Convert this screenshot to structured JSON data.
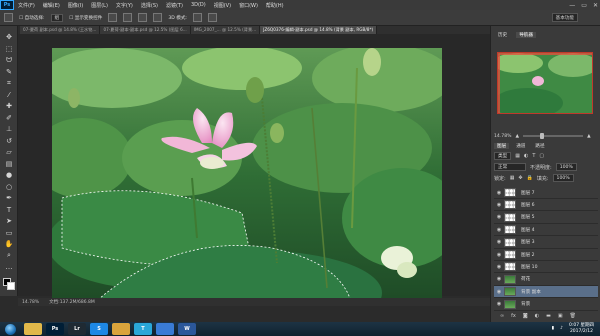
{
  "app": {
    "logo": "Ps"
  },
  "menubar": {
    "items": [
      "文件(F)",
      "编辑(E)",
      "图像(I)",
      "图层(L)",
      "文字(Y)",
      "选择(S)",
      "滤镜(T)",
      "3D(D)",
      "视图(V)",
      "窗口(W)",
      "帮助(H)"
    ],
    "controls": [
      "—",
      "▭",
      "✕"
    ]
  },
  "options": {
    "auto_select_label": "自动选择:",
    "auto_select_value": "组",
    "transform_label": "显示变换控件",
    "mode_label": "3D 模式:",
    "workspace": "基本功能"
  },
  "tabs": [
    {
      "label": "07-夏荷 副本.psd @ 14.8% (王水铭...",
      "active": false
    },
    {
      "label": "07-夏荷-副本-副本.psd @ 12.5% (图层 6...",
      "active": false
    },
    {
      "label": "IMG_2007_... @ 12.5% (背景...",
      "active": false
    },
    {
      "label": "JZ6Q0376-编辑-副本.psd @ 14.8% (背景 副本, RGB/8*)",
      "active": true
    }
  ],
  "tools": [
    "move-icon",
    "marquee-icon",
    "lasso-icon",
    "quick-select-icon",
    "crop-icon",
    "eyedropper-icon",
    "healing-icon",
    "brush-icon",
    "stamp-icon",
    "history-brush-icon",
    "eraser-icon",
    "gradient-icon",
    "blur-icon",
    "dodge-icon",
    "pen-icon",
    "type-icon",
    "path-select-icon",
    "shape-icon",
    "hand-icon",
    "zoom-icon",
    "more-icon"
  ],
  "status": {
    "zoom": "14.78%",
    "doc": "文档:137.2M/686.8M"
  },
  "navigator": {
    "tabs": [
      "历史",
      "导航器"
    ],
    "zoom": "14.78%",
    "zoom_fraction": 0.3
  },
  "layers": {
    "tabs": [
      "图层",
      "通道",
      "路径"
    ],
    "filter_label": "类型",
    "blend_mode": "正常",
    "opacity_label": "不透明度:",
    "opacity": "100%",
    "lock_label": "锁定:",
    "fill_label": "填充:",
    "fill": "100%",
    "rows": [
      {
        "name": "图层 7",
        "thumb": "checker",
        "selected": false
      },
      {
        "name": "图层 6",
        "thumb": "checker",
        "selected": false
      },
      {
        "name": "图层 5",
        "thumb": "checker",
        "selected": false
      },
      {
        "name": "图层 4",
        "thumb": "checker",
        "selected": false
      },
      {
        "name": "图层 3",
        "thumb": "checker",
        "selected": false
      },
      {
        "name": "图层 2",
        "thumb": "checker",
        "selected": false
      },
      {
        "name": "图层 10",
        "thumb": "checker",
        "selected": false
      },
      {
        "name": "荷花",
        "thumb": "green",
        "selected": false
      },
      {
        "name": "背景 副本",
        "thumb": "green",
        "selected": true
      },
      {
        "name": "背景",
        "thumb": "green",
        "selected": false
      }
    ],
    "bottom_icons": [
      "link-icon",
      "fx-icon",
      "mask-icon",
      "adjustment-icon",
      "group-icon",
      "new-layer-icon",
      "trash-icon"
    ]
  },
  "taskbar": {
    "apps": [
      {
        "name": "explorer",
        "label": "",
        "bg": "#e0b84a"
      },
      {
        "name": "photoshop",
        "label": "Ps",
        "bg": "#001e36"
      },
      {
        "name": "lightroom",
        "label": "Lr",
        "bg": "#1f2a33"
      },
      {
        "name": "browser",
        "label": "S",
        "bg": "#1e88e5"
      },
      {
        "name": "folder",
        "label": "",
        "bg": "#d9a43c"
      },
      {
        "name": "text-app",
        "label": "T",
        "bg": "#2aa7d8"
      },
      {
        "name": "pen-app",
        "label": "",
        "bg": "#3a7bd5"
      },
      {
        "name": "word",
        "label": "W",
        "bg": "#2b579a"
      }
    ],
    "time": "0:07 星期四",
    "date": "2017/2/12"
  },
  "colors": {
    "accent": "#31a8ff",
    "selected_layer": "#5a6f8a"
  }
}
